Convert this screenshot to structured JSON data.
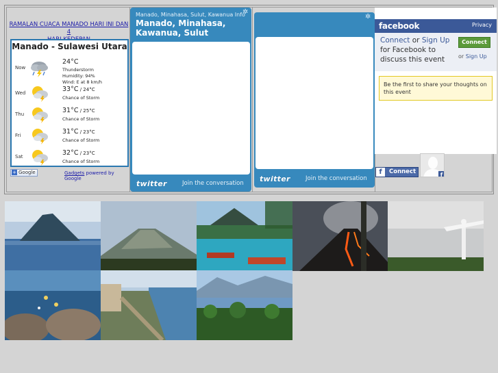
{
  "weather": {
    "link_line1": "RAMALAN CUACA MANADO HARI INI DAN 4",
    "link_line2": "HARI KEDEPAN",
    "title": "Manado - Sulawesi Utara",
    "now": {
      "day": "Now",
      "temp": "24°C",
      "condition": "Thunderstorm",
      "humidity": "Humidity: 94%",
      "wind": "Wind: E at 8 km/h",
      "icon": "thunderstorm-icon"
    },
    "forecast": [
      {
        "day": "Wed",
        "high": "33°C",
        "low": "24°C",
        "condition": "Chance of Storm",
        "icon": "chance-of-storm-icon"
      },
      {
        "day": "Thu",
        "high": "31°C",
        "low": "25°C",
        "condition": "Chance of Storm",
        "icon": "chance-of-storm-icon"
      },
      {
        "day": "Fri",
        "high": "31°C",
        "low": "23°C",
        "condition": "Chance of Storm",
        "icon": "chance-of-storm-icon"
      },
      {
        "day": "Sat",
        "high": "32°C",
        "low": "23°C",
        "condition": "Chance of Storm",
        "icon": "chance-of-storm-icon"
      }
    ],
    "google_badge": "Google",
    "gadgets_link": "Gadgets",
    "powered_by": "powered by Google",
    "low_separator": " / "
  },
  "twitter1": {
    "subtitle": "Manado, Minahasa, Sulut, Kawanua Info",
    "title_line1": "Manado, Minahasa,",
    "title_line2": "Kawanua, Sulut",
    "logo": "twitter",
    "join": "Join the conversation"
  },
  "twitter2": {
    "logo": "twitter",
    "join": "Join the conversation"
  },
  "facebook": {
    "logo": "facebook",
    "privacy": "Privacy",
    "connect_link": "Connect",
    "or": " or ",
    "signup_link": "Sign Up",
    "connect_text_rest": " for Facebook to discuss this event",
    "connect_button": "Connect",
    "or_signup_prefix": "or ",
    "or_signup_link": "Sign Up",
    "notice": "Be the first to share your thoughts on this event",
    "fb_connect_button": "Connect"
  },
  "colors": {
    "twitter_blue": "#3789bd",
    "facebook_blue": "#3b5998",
    "connect_green": "#5b9a3a",
    "link_blue": "#1a1aa8"
  },
  "photos": [
    {
      "name": "island-volcano-sea"
    },
    {
      "name": "volcano-mountain"
    },
    {
      "name": "boats-lagoon"
    },
    {
      "name": "erupting-volcano"
    },
    {
      "name": "jesus-statue"
    },
    {
      "name": "coral-reef"
    },
    {
      "name": "coastal-boulevard"
    },
    {
      "name": "palm-forest-bay"
    }
  ]
}
